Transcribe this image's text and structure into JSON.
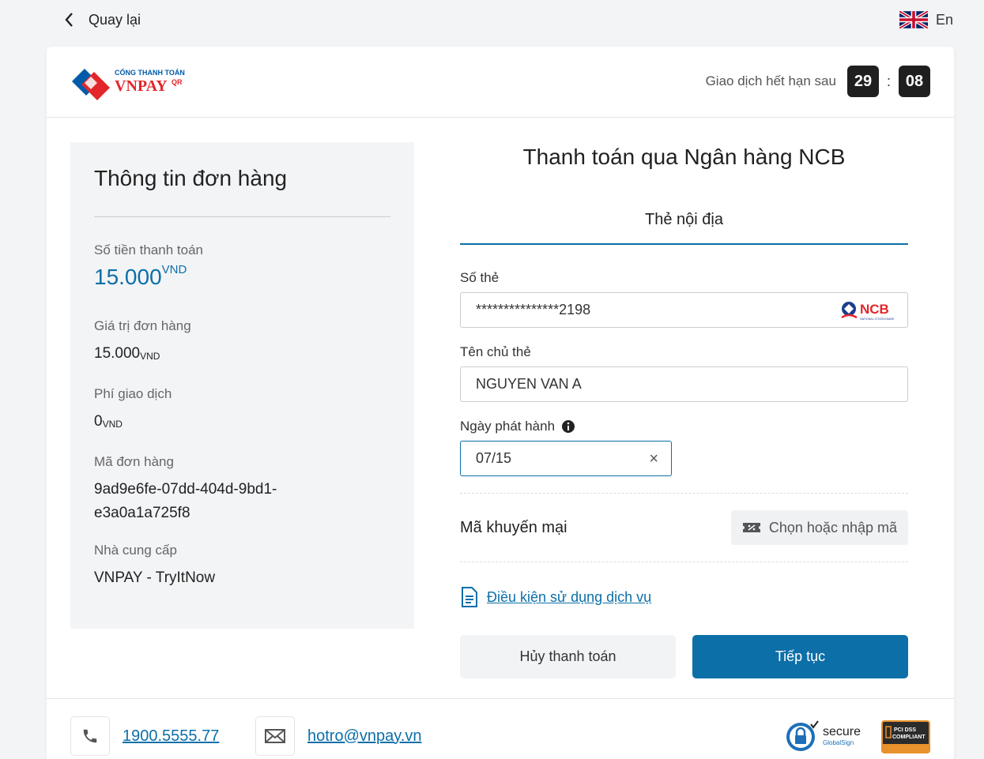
{
  "topbar": {
    "back_label": "Quay lại",
    "lang_label": "En"
  },
  "header": {
    "logo": {
      "line1": "CỔNG THANH TOÁN",
      "line2": "VNPAY",
      "line3": "QR"
    },
    "expire_label": "Giao dịch hết hạn sau",
    "minutes": "29",
    "separator": ":",
    "seconds": "08"
  },
  "order": {
    "title": "Thông tin đơn hàng",
    "amount_label": "Số tiền thanh toán",
    "amount_value": "15.000",
    "currency": "VND",
    "order_value_label": "Giá trị đơn hàng",
    "order_value": "15.000",
    "fee_label": "Phí giao dịch",
    "fee_value": "0",
    "order_id_label": "Mã đơn hàng",
    "order_id_line1": "9ad9e6fe-07dd-404d-9bd1-",
    "order_id_line2": "e3a0a1a725f8",
    "provider_label": "Nhà cung cấp",
    "provider_value": "VNPAY - TryItNow"
  },
  "payment": {
    "title": "Thanh toán qua Ngân hàng NCB",
    "tab_label": "Thẻ nội địa",
    "card_number_label": "Số thẻ",
    "card_number_value": "***************2198",
    "bank_logo": {
      "text": "NCB",
      "subtext": "NATIONAL CITIZEN BANK"
    },
    "holder_label": "Tên chủ thẻ",
    "holder_value": "NGUYEN VAN A",
    "issue_date_label": "Ngày phát hành",
    "issue_date_value": "07/15",
    "clear_icon_glyph": "×",
    "promo_label": "Mã khuyến mại",
    "promo_button": "Chọn hoặc nhập mã",
    "terms_link": "Điều kiện sử dụng dịch vụ",
    "cancel_button": "Hủy thanh toán",
    "continue_button": "Tiếp tục"
  },
  "footer": {
    "phone": "1900.5555.77",
    "email": "hotro@vnpay.vn",
    "secure_badge": {
      "title": "secure",
      "subtitle": "GlobalSign"
    },
    "pci_badge": {
      "line1": "PCI DSS",
      "line2": "COMPLIANT"
    }
  },
  "colors": {
    "accent": "#0d6fa8",
    "timer_bg": "#1f1f1f",
    "logo_red": "#e3262b",
    "logo_blue": "#005baa"
  },
  "icons": [
    "chevron-left-icon",
    "uk-flag-icon",
    "info-icon",
    "close-icon",
    "ticket-icon",
    "document-icon",
    "phone-icon",
    "mail-icon",
    "lock-icon"
  ]
}
